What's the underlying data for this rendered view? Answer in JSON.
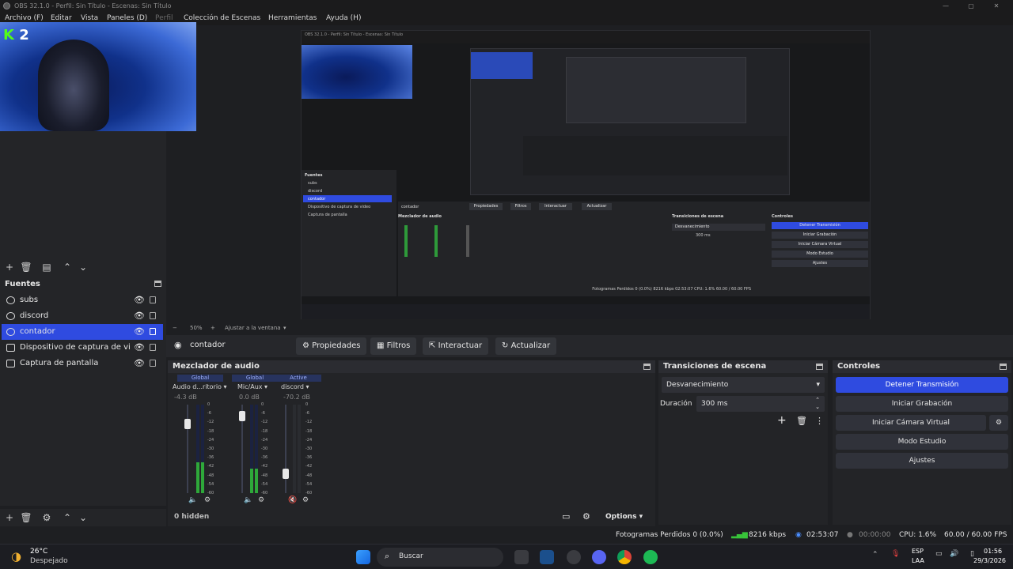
{
  "window": {
    "title": "OBS 32.1.0 - Perfil: Sin Título - Escenas: Sin Título",
    "minimize": "—",
    "maximize": "▢",
    "close": "✕"
  },
  "menu": [
    "Archivo (F)",
    "Editar",
    "Vista",
    "Paneles (D)",
    "Perfil",
    "Colección de Escenas",
    "Herramientas",
    "Ayuda (H)"
  ],
  "preview": {
    "overlay_letter": "K",
    "overlay_number": "2",
    "zoom_minus": "−",
    "zoom_value": "50%",
    "zoom_plus": "+",
    "zoom_mode": "Ajustar a la ventana"
  },
  "nested": {
    "title": "OBS 32.1.0 - Perfil: Sin Título - Escenas: Sin Título",
    "sources_title": "Fuentes",
    "sources": [
      "subs",
      "discord",
      "contador",
      "Dispositivo de captura de video",
      "Captura de pantalla"
    ],
    "context": "contador",
    "buttons": [
      "Propiedades",
      "Filtros",
      "Interactuar",
      "Actualizar"
    ],
    "mixer_title": "Mezclador de audio",
    "transitions_title": "Transiciones de escena",
    "controls_title": "Controles",
    "controls": [
      "Detener Transmisión",
      "Iniciar Grabación",
      "Iniciar Cámara Virtual",
      "Modo Estudio",
      "Ajustes"
    ],
    "transition": "Desvanecimiento",
    "duration": "300 ms",
    "status": "Fotogramas Perdidos 0 (0.0%)   8216 kbps   02:53:07   CPU: 1.6%   60.00 / 60.00 FPS"
  },
  "sources_dock": {
    "title": "Fuentes",
    "items": [
      {
        "label": "subs",
        "icon": "text-icon"
      },
      {
        "label": "discord",
        "icon": "browser-icon"
      },
      {
        "label": "contador",
        "icon": "browser-icon",
        "selected": true
      },
      {
        "label": "Dispositivo de captura de video",
        "icon": "camera-icon"
      },
      {
        "label": "Captura de pantalla",
        "icon": "monitor-icon"
      }
    ]
  },
  "context_bar": {
    "source": "contador",
    "properties": "Propiedades",
    "filters": "Filtros",
    "interact": "Interactuar",
    "refresh": "Actualizar"
  },
  "mixer": {
    "title": "Mezclador de audio",
    "channels": [
      {
        "tag": "Global",
        "name": "Audio d...ritorio",
        "db": "-4.3 dB",
        "level": 0.35,
        "fader": 0.82
      },
      {
        "tag": "Global",
        "name": "Mic/Aux",
        "db": "0.0 dB",
        "level": 0.28,
        "fader": 0.92
      },
      {
        "tag": "Active",
        "name": "discord",
        "db": "-70.2 dB",
        "level": 0.0,
        "fader": 0.18
      }
    ],
    "scale": [
      "0",
      "-6",
      "-12",
      "-18",
      "-24",
      "-30",
      "-36",
      "-42",
      "-48",
      "-54",
      "-60"
    ],
    "hidden": "0 hidden",
    "options": "Options"
  },
  "transitions": {
    "title": "Transiciones de escena",
    "selected": "Desvanecimiento",
    "duration_label": "Duración",
    "duration_value": "300 ms"
  },
  "controls": {
    "title": "Controles",
    "stop_stream": "Detener Transmisión",
    "start_record": "Iniciar Grabación",
    "virtual_cam": "Iniciar Cámara Virtual",
    "studio_mode": "Modo Estudio",
    "settings": "Ajustes"
  },
  "status": {
    "dropped_frames": "Fotogramas Perdidos 0 (0.0%)",
    "bitrate": "8216 kbps",
    "stream_time": "02:53:07",
    "record_time": "00:00:00",
    "cpu": "CPU: 1.6%",
    "fps": "60.00 / 60.00 FPS"
  },
  "taskbar": {
    "weather_temp": "26°C",
    "weather_desc": "Despejado",
    "search": "Buscar",
    "lang1": "ESP",
    "lang2": "LAA",
    "time": "01:56",
    "date": "29/3/2026"
  },
  "colors": {
    "accent": "#2f4be0",
    "bg": "#1e1f22",
    "panel": "#232427"
  }
}
